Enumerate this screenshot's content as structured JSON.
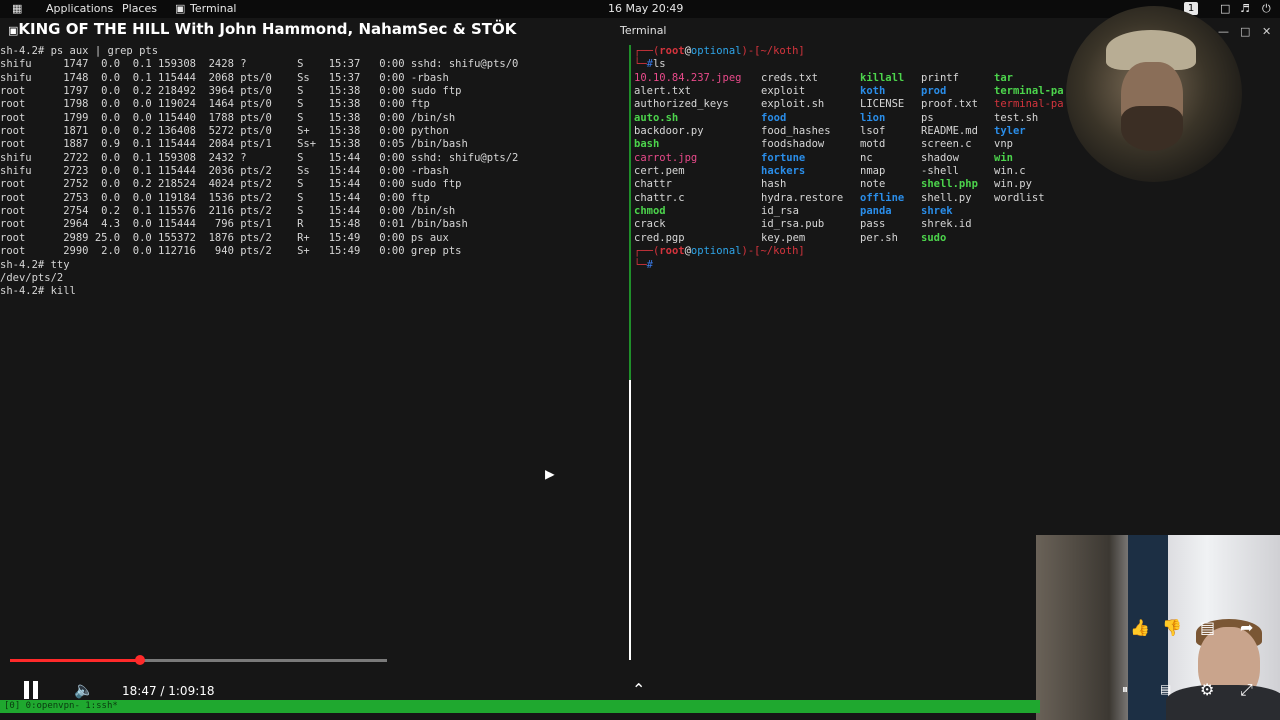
{
  "topbar": {
    "applications": "Applications",
    "places": "Places",
    "terminal": "Terminal",
    "clock": "16 May 20:49",
    "workspace": "1"
  },
  "video": {
    "title": "KING OF THE HILL With John Hammond, NahamSec & STÖK",
    "time_display": "18:47 / 1:09:18",
    "progress": 0.271
  },
  "window": {
    "title": "Terminal"
  },
  "left_pane": {
    "lines": [
      "sh-4.2# ps aux | grep pts",
      "shifu     1747  0.0  0.1 159308  2428 ?        S    15:37   0:00 sshd: shifu@pts/0",
      "shifu     1748  0.0  0.1 115444  2068 pts/0    Ss   15:37   0:00 -rbash",
      "root      1797  0.0  0.2 218492  3964 pts/0    S    15:38   0:00 sudo ftp",
      "root      1798  0.0  0.0 119024  1464 pts/0    S    15:38   0:00 ftp",
      "root      1799  0.0  0.0 115440  1788 pts/0    S    15:38   0:00 /bin/sh",
      "root      1871  0.0  0.2 136408  5272 pts/0    S+   15:38   0:00 python",
      "root      1887  0.9  0.1 115444  2084 pts/1    Ss+  15:38   0:05 /bin/bash",
      "shifu     2722  0.0  0.1 159308  2432 ?        S    15:44   0:00 sshd: shifu@pts/2",
      "shifu     2723  0.0  0.1 115444  2036 pts/2    Ss   15:44   0:00 -rbash",
      "root      2752  0.0  0.2 218524  4024 pts/2    S    15:44   0:00 sudo ftp",
      "root      2753  0.0  0.0 119184  1536 pts/2    S    15:44   0:00 ftp",
      "root      2754  0.2  0.1 115576  2116 pts/2    S    15:44   0:00 /bin/sh",
      "root      2964  4.3  0.0 115444   796 pts/1    R    15:48   0:01 /bin/bash",
      "root      2989 25.0  0.0 155372  1876 pts/2    R+   15:49   0:00 ps aux",
      "root      2990  2.0  0.0 112716   940 pts/2    S+   15:49   0:00 grep pts",
      "sh-4.2# tty",
      "/dev/pts/2",
      "sh-4.2# kill"
    ]
  },
  "right_pane": {
    "prompt": {
      "user": "root",
      "at": "@",
      "host": "optional",
      "dir": "~/koth",
      "hash": "#"
    },
    "command": "ls",
    "ls_rows": [
      [
        {
          "t": "10.10.84.237.jpeg",
          "c": "pink"
        },
        {
          "t": "creds.txt",
          "c": "file"
        },
        {
          "t": "killall",
          "c": "green"
        },
        {
          "t": "printf",
          "c": "file"
        },
        {
          "t": "tar",
          "c": "green"
        }
      ],
      [
        {
          "t": "alert.txt",
          "c": "file"
        },
        {
          "t": "exploit",
          "c": "file"
        },
        {
          "t": "koth",
          "c": "blue"
        },
        {
          "t": "prod",
          "c": "blue"
        },
        {
          "t": "terminal-pa",
          "c": "green"
        }
      ],
      [
        {
          "t": "authorized_keys",
          "c": "file"
        },
        {
          "t": "exploit.sh",
          "c": "file"
        },
        {
          "t": "LICENSE",
          "c": "file"
        },
        {
          "t": "proof.txt",
          "c": "file"
        },
        {
          "t": "terminal-pa",
          "c": "red"
        }
      ],
      [
        {
          "t": "auto.sh",
          "c": "green"
        },
        {
          "t": "food",
          "c": "blue"
        },
        {
          "t": "lion",
          "c": "blue"
        },
        {
          "t": "ps",
          "c": "file"
        },
        {
          "t": "test.sh",
          "c": "file"
        }
      ],
      [
        {
          "t": "backdoor.py",
          "c": "file"
        },
        {
          "t": "food_hashes",
          "c": "file"
        },
        {
          "t": "lsof",
          "c": "file"
        },
        {
          "t": "README.md",
          "c": "file"
        },
        {
          "t": "tyler",
          "c": "blue"
        }
      ],
      [
        {
          "t": "bash",
          "c": "green"
        },
        {
          "t": "foodshadow",
          "c": "file"
        },
        {
          "t": "motd",
          "c": "file"
        },
        {
          "t": "screen.c",
          "c": "file"
        },
        {
          "t": "vnp",
          "c": "file"
        }
      ],
      [
        {
          "t": "carrot.jpg",
          "c": "pink"
        },
        {
          "t": "fortune",
          "c": "blue"
        },
        {
          "t": "nc",
          "c": "file"
        },
        {
          "t": "shadow",
          "c": "file"
        },
        {
          "t": "win",
          "c": "green"
        }
      ],
      [
        {
          "t": "cert.pem",
          "c": "file"
        },
        {
          "t": "hackers",
          "c": "blue"
        },
        {
          "t": "nmap",
          "c": "file"
        },
        {
          "t": "-shell",
          "c": "file"
        },
        {
          "t": "win.c",
          "c": "file"
        }
      ],
      [
        {
          "t": "chattr",
          "c": "file"
        },
        {
          "t": "hash",
          "c": "file"
        },
        {
          "t": "note",
          "c": "file"
        },
        {
          "t": "shell.php",
          "c": "green"
        },
        {
          "t": "win.py",
          "c": "file"
        }
      ],
      [
        {
          "t": "chattr.c",
          "c": "file"
        },
        {
          "t": "hydra.restore",
          "c": "file"
        },
        {
          "t": "offline",
          "c": "blue"
        },
        {
          "t": "shell.py",
          "c": "file"
        },
        {
          "t": "wordlist",
          "c": "file"
        }
      ],
      [
        {
          "t": "chmod",
          "c": "green"
        },
        {
          "t": "id_rsa",
          "c": "file"
        },
        {
          "t": "panda",
          "c": "blue"
        },
        {
          "t": "shrek",
          "c": "blue"
        },
        {
          "t": "",
          "c": "file"
        }
      ],
      [
        {
          "t": "crack",
          "c": "file"
        },
        {
          "t": "id_rsa.pub",
          "c": "file"
        },
        {
          "t": "pass",
          "c": "file"
        },
        {
          "t": "shrek.id",
          "c": "file"
        },
        {
          "t": "",
          "c": "file"
        }
      ],
      [
        {
          "t": "cred.pgp",
          "c": "file"
        },
        {
          "t": "key.pem",
          "c": "file"
        },
        {
          "t": "per.sh",
          "c": "file"
        },
        {
          "t": "sudo",
          "c": "green"
        },
        {
          "t": "",
          "c": "file"
        }
      ]
    ]
  },
  "tmux": {
    "status": "[0] 0:openvpn- 1:ssh*"
  },
  "colors": {
    "tmux_bar": "#1fa82f",
    "progress": "#ff2a2a",
    "divider": "#1f8f2a"
  }
}
